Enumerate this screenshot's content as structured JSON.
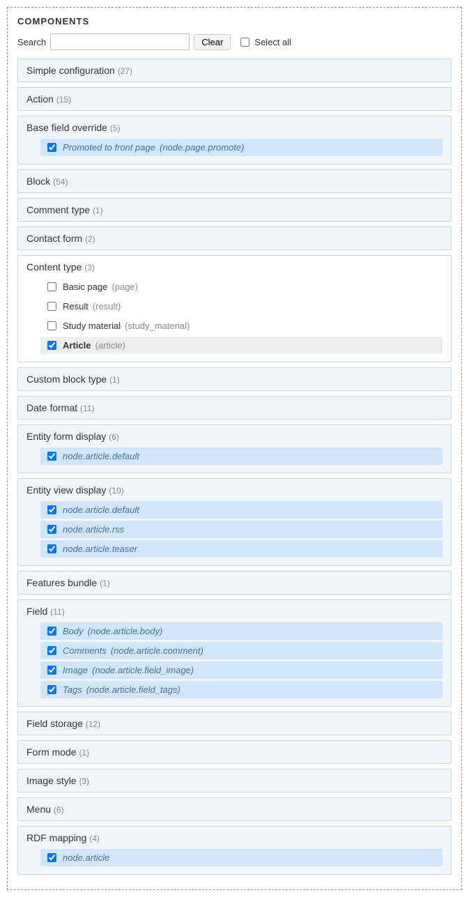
{
  "title": "COMPONENTS",
  "toolbar": {
    "search_label": "Search",
    "search_value": "",
    "clear_label": "Clear",
    "selectall_label": "Select all"
  },
  "groups": [
    {
      "label": "Simple configuration",
      "count": "(27)",
      "expanded": false,
      "children": []
    },
    {
      "label": "Action",
      "count": "(15)",
      "expanded": false,
      "children": []
    },
    {
      "label": "Base field override",
      "count": "(5)",
      "expanded": true,
      "header_bg": true,
      "children": [
        {
          "label": "Promoted to front page",
          "machine": "(node.page.promote)",
          "checked": true,
          "style": "italic",
          "highlight": true
        }
      ]
    },
    {
      "label": "Block",
      "count": "(54)",
      "expanded": false,
      "children": []
    },
    {
      "label": "Comment type",
      "count": "(1)",
      "expanded": false,
      "children": []
    },
    {
      "label": "Contact form",
      "count": "(2)",
      "expanded": false,
      "children": []
    },
    {
      "label": "Content type",
      "count": "(3)",
      "expanded": true,
      "white_bg": true,
      "children": [
        {
          "label": "Basic page",
          "machine": "(page)",
          "checked": false,
          "style": "normal"
        },
        {
          "label": "Result",
          "machine": "(result)",
          "checked": false,
          "style": "normal"
        },
        {
          "label": "Study material",
          "machine": "(study_material)",
          "checked": false,
          "style": "normal"
        },
        {
          "label": "Article",
          "machine": "(article)",
          "checked": true,
          "style": "normal-bold",
          "gray": true
        }
      ]
    },
    {
      "label": "Custom block type",
      "count": "(1)",
      "expanded": false,
      "children": []
    },
    {
      "label": "Date format",
      "count": "(11)",
      "expanded": false,
      "children": []
    },
    {
      "label": "Entity form display",
      "count": "(6)",
      "expanded": true,
      "header_bg": true,
      "children": [
        {
          "label": "node.article.default",
          "machine": "",
          "checked": true,
          "style": "italic",
          "highlight": true
        }
      ]
    },
    {
      "label": "Entity view display",
      "count": "(10)",
      "expanded": true,
      "header_bg": true,
      "children": [
        {
          "label": "node.article.default",
          "machine": "",
          "checked": true,
          "style": "italic",
          "highlight": true
        },
        {
          "label": "node.article.rss",
          "machine": "",
          "checked": true,
          "style": "italic",
          "highlight": true
        },
        {
          "label": "node.article.teaser",
          "machine": "",
          "checked": true,
          "style": "italic",
          "highlight": true
        }
      ]
    },
    {
      "label": "Features bundle",
      "count": "(1)",
      "expanded": false,
      "children": []
    },
    {
      "label": "Field",
      "count": "(11)",
      "expanded": true,
      "header_bg": true,
      "children": [
        {
          "label": "Body",
          "machine": "(node.article.body)",
          "checked": true,
          "style": "italic",
          "highlight": true
        },
        {
          "label": "Comments",
          "machine": "(node.article.comment)",
          "checked": true,
          "style": "italic",
          "highlight": true
        },
        {
          "label": "Image",
          "machine": "(node.article.field_image)",
          "checked": true,
          "style": "italic",
          "highlight": true
        },
        {
          "label": "Tags",
          "machine": "(node.article.field_tags)",
          "checked": true,
          "style": "italic",
          "highlight": true
        }
      ]
    },
    {
      "label": "Field storage",
      "count": "(12)",
      "expanded": false,
      "children": []
    },
    {
      "label": "Form mode",
      "count": "(1)",
      "expanded": false,
      "children": []
    },
    {
      "label": "Image style",
      "count": "(3)",
      "expanded": false,
      "children": []
    },
    {
      "label": "Menu",
      "count": "(6)",
      "expanded": false,
      "children": []
    },
    {
      "label": "RDF mapping",
      "count": "(4)",
      "expanded": true,
      "header_bg": true,
      "children": [
        {
          "label": "node.article",
          "machine": "",
          "checked": true,
          "style": "italic",
          "highlight": true
        }
      ]
    }
  ]
}
